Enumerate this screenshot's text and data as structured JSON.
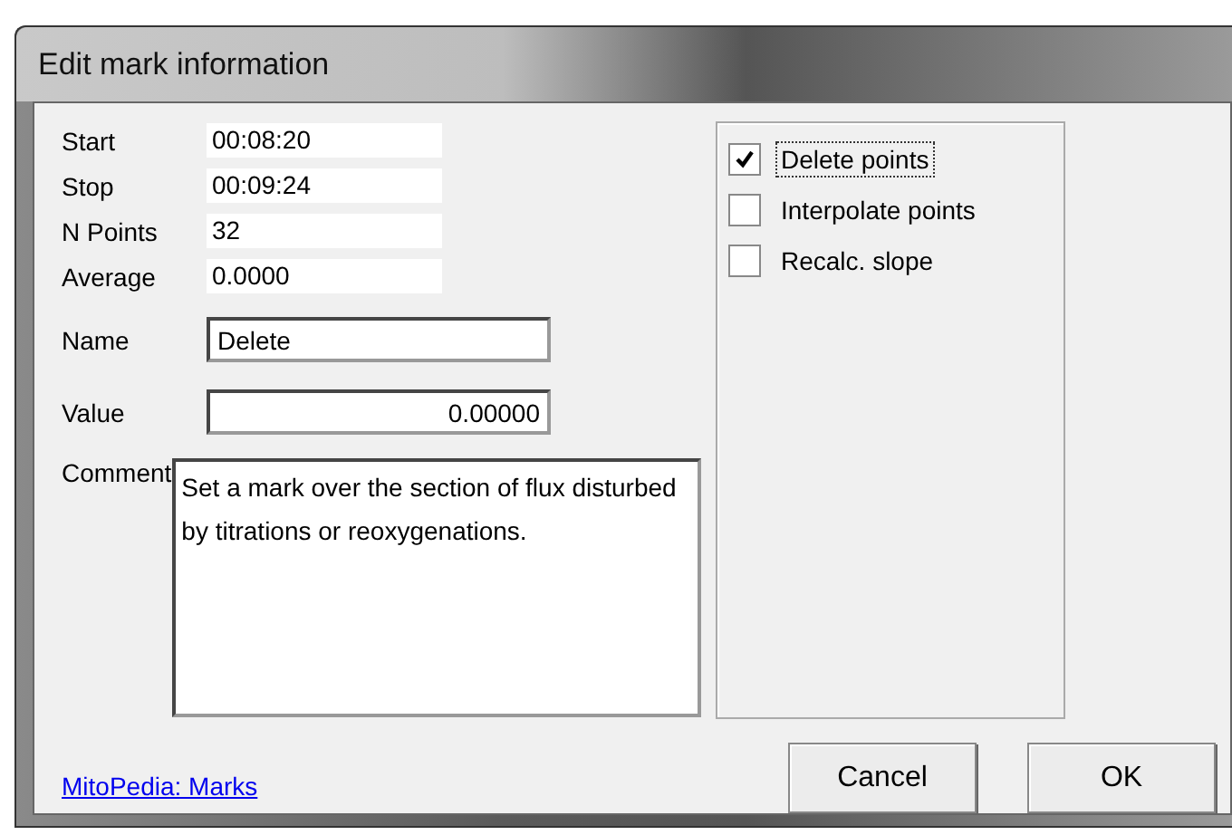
{
  "window": {
    "title": "Edit mark information"
  },
  "info": [
    {
      "label": "Start",
      "value": "00:08:20"
    },
    {
      "label": "Stop",
      "value": "00:09:24"
    },
    {
      "label": "N Points",
      "value": "32"
    },
    {
      "label": "Average",
      "value": "0.0000"
    }
  ],
  "name": {
    "label": "Name",
    "value": "Delete"
  },
  "value": {
    "label": "Value",
    "value": "0.00000"
  },
  "comment": {
    "label": "Comment",
    "value": "Set a mark over the section of flux disturbed by titrations or reoxygenations."
  },
  "options": [
    {
      "label": "Delete points",
      "checked": true,
      "focused": true
    },
    {
      "label": "Interpolate points",
      "checked": false,
      "focused": false
    },
    {
      "label": "Recalc. slope",
      "checked": false,
      "focused": false
    }
  ],
  "link": "MitoPedia: Marks",
  "buttons": [
    "Cancel",
    "OK"
  ]
}
